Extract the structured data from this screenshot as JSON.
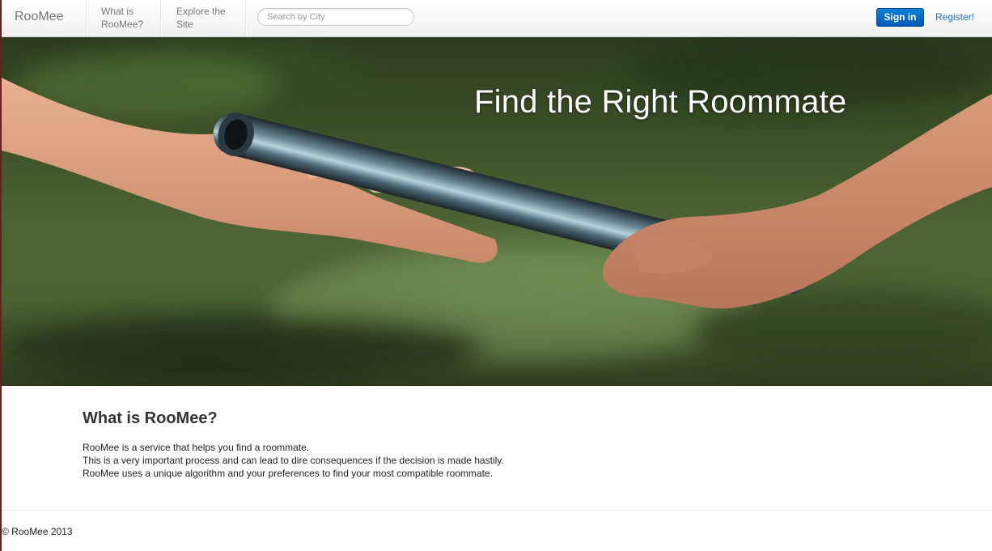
{
  "navbar": {
    "brand": "RooMee",
    "links": [
      {
        "label": "What is RooMee?"
      },
      {
        "label": "Explore the Site"
      }
    ],
    "search": {
      "placeholder": "Search by City",
      "value": ""
    },
    "signin_label": "Sign in",
    "register_label": "Register!"
  },
  "hero": {
    "title": "Find the Right Roommate",
    "image_alt": "two hands passing a relay baton"
  },
  "about": {
    "heading": "What is RooMee?",
    "lines": [
      "RooMee is a service that helps you find a roommate.",
      "This is a very important process and can lead to dire consequences if the decision is made hastily.",
      "RooMee uses a unique algorithm and your preferences to find your most compatible roommate."
    ]
  },
  "footer": {
    "copyright": "© RooMee 2013"
  },
  "colors": {
    "accent": "#0a6fcf",
    "link": "#1b73c6",
    "hero_background": "#3d5228"
  }
}
